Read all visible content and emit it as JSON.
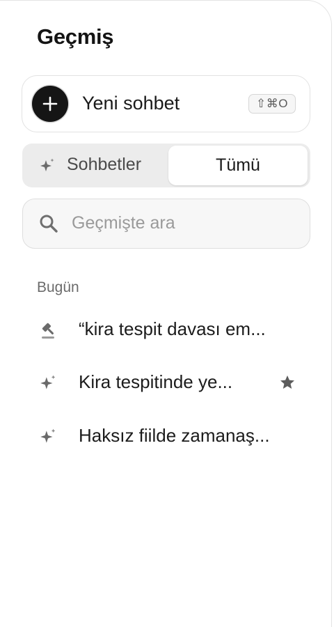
{
  "panel": {
    "title": "Geçmiş"
  },
  "new_chat": {
    "label": "Yeni sohbet",
    "shortcut": "⇧⌘O",
    "icon": "plus-icon"
  },
  "tabs": {
    "chats_label": "Sohbetler",
    "all_label": "Tümü",
    "selected": "Tümü"
  },
  "search": {
    "placeholder": "Geçmişte ara",
    "value": ""
  },
  "history": {
    "section_label": "Bugün",
    "items": [
      {
        "label": "“kira tespit davası em...",
        "icon": "gavel-icon",
        "starred": false
      },
      {
        "label": "Kira tespitinde ye...",
        "icon": "sparkle-icon",
        "starred": true
      },
      {
        "label": "Haksız fiilde zamanaş...",
        "icon": "sparkle-icon",
        "starred": false
      }
    ]
  },
  "colors": {
    "accent_dark": "#151515",
    "tab_bg": "#ececec",
    "muted_text": "#6b6b6b",
    "icon_gray": "#6f6f6f"
  }
}
